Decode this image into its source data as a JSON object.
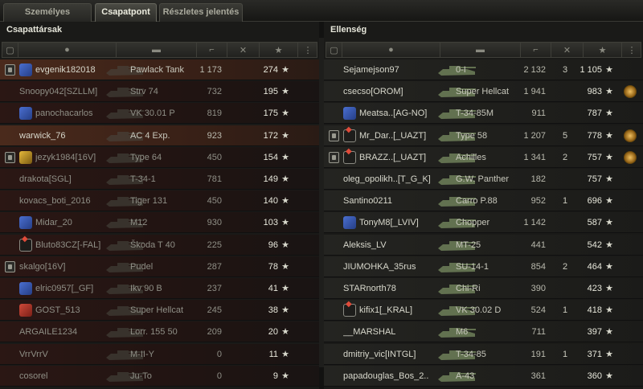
{
  "tabs": [
    {
      "label": "Személyes eredmény",
      "active": false
    },
    {
      "label": "Csapatpont",
      "active": true
    },
    {
      "label": "Részletes jelentés",
      "active": false
    }
  ],
  "allies": {
    "title": "Csapattársak",
    "rows": [
      {
        "name": "evgenik182018",
        "tank": "Pawlack Tank",
        "damage": "1 173",
        "xp": "274",
        "platoon": true,
        "clan": "blue",
        "dead": false,
        "self": true
      },
      {
        "name": "Snoopy042[SZLLM]",
        "tank": "Strv 74",
        "damage": "732",
        "xp": "195",
        "platoon": false,
        "clan": "",
        "dead": true,
        "self": false
      },
      {
        "name": "panochacarlos",
        "tank": "VK 30.01 P",
        "damage": "819",
        "xp": "175",
        "platoon": false,
        "clan": "blue",
        "dead": true,
        "self": false
      },
      {
        "name": "warwick_76",
        "tank": "AC 4 Exp.",
        "damage": "923",
        "xp": "172",
        "platoon": false,
        "clan": "",
        "dead": false,
        "self": true
      },
      {
        "name": "jezyk1984[16V]",
        "tank": "Type 64",
        "damage": "450",
        "xp": "154",
        "platoon": true,
        "clan": "yellow",
        "dead": true,
        "self": false
      },
      {
        "name": "drakota[SGL]",
        "tank": "T-34-1",
        "damage": "781",
        "xp": "149",
        "platoon": false,
        "clan": "",
        "dead": true,
        "self": false
      },
      {
        "name": "kovacs_boti_2016",
        "tank": "Tiger 131",
        "damage": "450",
        "xp": "140",
        "platoon": false,
        "clan": "",
        "dead": true,
        "self": false
      },
      {
        "name": "Midar_20",
        "tank": "M12",
        "damage": "930",
        "xp": "103",
        "platoon": false,
        "clan": "blue",
        "dead": true,
        "self": false
      },
      {
        "name": "Bluto83CZ[-FAL]",
        "tank": "Škoda T 40",
        "damage": "225",
        "xp": "96",
        "platoon": false,
        "clan": "white",
        "dead": true,
        "self": false
      },
      {
        "name": "skalgo[16V]",
        "tank": "Pudel",
        "damage": "287",
        "xp": "78",
        "platoon": true,
        "clan": "",
        "dead": true,
        "self": false
      },
      {
        "name": "elric0957[_GF]",
        "tank": "Ikv 90 B",
        "damage": "237",
        "xp": "41",
        "platoon": false,
        "clan": "blue",
        "dead": true,
        "self": false
      },
      {
        "name": "GOST_513",
        "tank": "Super Hellcat",
        "damage": "245",
        "xp": "38",
        "platoon": false,
        "clan": "red",
        "dead": true,
        "self": false
      },
      {
        "name": "ARGAILE1234",
        "tank": "Lorr. 155 50",
        "damage": "209",
        "xp": "20",
        "platoon": false,
        "clan": "",
        "dead": true,
        "self": false
      },
      {
        "name": "VrrVrrV",
        "tank": "M-II-Y",
        "damage": "0",
        "xp": "11",
        "platoon": false,
        "clan": "",
        "dead": true,
        "self": false
      },
      {
        "name": "cosorel",
        "tank": "Ju-To",
        "damage": "0",
        "xp": "9",
        "platoon": false,
        "clan": "",
        "dead": true,
        "self": false
      }
    ]
  },
  "enemies": {
    "title": "Ellenség",
    "rows": [
      {
        "name": "Sejamejson97",
        "tank": "0-I",
        "damage": "2 132",
        "kills": "3",
        "xp": "1 105",
        "platoon": false,
        "clan": "",
        "medal": false,
        "dead": false
      },
      {
        "name": "csecso[OROM]",
        "tank": "Super Hellcat",
        "damage": "1 941",
        "kills": "",
        "xp": "983",
        "platoon": false,
        "clan": "",
        "medal": true,
        "dead": false
      },
      {
        "name": "Meatsa..[AG-NO]",
        "tank": "T-34-85M",
        "damage": "911",
        "kills": "",
        "xp": "787",
        "platoon": false,
        "clan": "blue",
        "medal": false,
        "dead": false
      },
      {
        "name": "Mr_Dar..[_UAZT]",
        "tank": "Type 58",
        "damage": "1 207",
        "kills": "5",
        "xp": "778",
        "platoon": true,
        "clan": "white",
        "medal": true,
        "dead": false
      },
      {
        "name": "BRAZZ..[_UAZT]",
        "tank": "Achilles",
        "damage": "1 341",
        "kills": "2",
        "xp": "757",
        "platoon": true,
        "clan": "white",
        "medal": true,
        "dead": false
      },
      {
        "name": "oleg_opolikh..[T_G_K]",
        "tank": "G.W. Panther",
        "damage": "182",
        "kills": "",
        "xp": "757",
        "platoon": false,
        "clan": "",
        "medal": false,
        "dead": false
      },
      {
        "name": "Santino0211",
        "tank": "Carro P.88",
        "damage": "952",
        "kills": "1",
        "xp": "696",
        "platoon": false,
        "clan": "",
        "medal": false,
        "dead": false
      },
      {
        "name": "TonyM8[_LVIV]",
        "tank": "Chopper",
        "damage": "1 142",
        "kills": "",
        "xp": "587",
        "platoon": false,
        "clan": "blue",
        "medal": false,
        "dead": false
      },
      {
        "name": "Aleksis_LV",
        "tank": "MT-25",
        "damage": "441",
        "kills": "",
        "xp": "542",
        "platoon": false,
        "clan": "",
        "medal": false,
        "dead": false
      },
      {
        "name": "JIUMOHKA_35rus",
        "tank": "SU-14-1",
        "damage": "854",
        "kills": "2",
        "xp": "464",
        "platoon": false,
        "clan": "",
        "medal": false,
        "dead": false
      },
      {
        "name": "STARnorth78",
        "tank": "Chi-Ri",
        "damage": "390",
        "kills": "",
        "xp": "423",
        "platoon": false,
        "clan": "",
        "medal": false,
        "dead": false
      },
      {
        "name": "kifix1[_KRAL]",
        "tank": "VK 30.02 D",
        "damage": "524",
        "kills": "1",
        "xp": "418",
        "platoon": false,
        "clan": "white",
        "medal": false,
        "dead": false
      },
      {
        "name": "__MARSHAL",
        "tank": "M6",
        "damage": "711",
        "kills": "",
        "xp": "397",
        "platoon": false,
        "clan": "",
        "medal": false,
        "dead": false
      },
      {
        "name": "dmitriy_vic[INTGL]",
        "tank": "T-34-85",
        "damage": "191",
        "kills": "1",
        "xp": "371",
        "platoon": false,
        "clan": "",
        "medal": false,
        "dead": false
      },
      {
        "name": "papadouglas_Bos_2..",
        "tank": "A-43",
        "damage": "361",
        "kills": "",
        "xp": "360",
        "platoon": false,
        "clan": "",
        "medal": false,
        "dead": false
      }
    ]
  },
  "star_glyph": "★",
  "icons": [
    "platoon-icon",
    "player-icon",
    "tank-icon",
    "damage-icon",
    "kills-icon",
    "xp-star-icon",
    "more-icon",
    "medal-icon"
  ]
}
